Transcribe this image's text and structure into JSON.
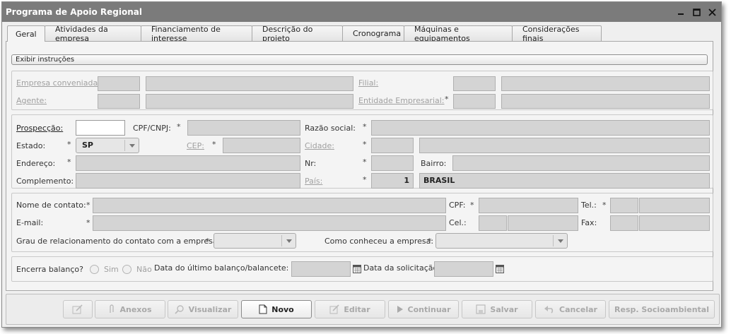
{
  "window": {
    "title": "Programa de Apoio Regional"
  },
  "tabs": [
    {
      "label": "Geral"
    },
    {
      "label": "Atividades da empresa"
    },
    {
      "label": "Financiamento de interesse"
    },
    {
      "label": "Descrição do projeto"
    },
    {
      "label": "Cronograma"
    },
    {
      "label": "Máquinas e equipamentos"
    },
    {
      "label": "Considerações finais"
    }
  ],
  "instructions_label": "Exibir instruções",
  "company": {
    "empresa_conveniada": "Empresa conveniada:",
    "filial": "Filial:",
    "agente": "Agente:",
    "entidade_empresarial": "Entidade Empresarial:"
  },
  "prospect": {
    "prospeccao": "Prospecção:",
    "cpf_cnpj": "CPF/CNPJ:",
    "razao_social": "Razão social:",
    "estado": "Estado:",
    "estado_value": "SP",
    "cep": "CEP:",
    "cidade": "Cidade:",
    "endereco": "Endereço:",
    "nr": "Nr:",
    "bairro": "Bairro:",
    "complemento": "Complemento:",
    "pais": "País:",
    "pais_code": "1",
    "pais_name": "BRASIL"
  },
  "contact": {
    "nome": "Nome de contato:",
    "cpf": "CPF:",
    "tel": "Tel.:",
    "email": "E-mail:",
    "cel": "Cel.:",
    "fax": "Fax:",
    "grau": "Grau de relacionamento do contato com a empresa:",
    "como": "Como conheceu a empresa:"
  },
  "balance": {
    "encerra": "Encerra balanço?",
    "sim": "Sim",
    "nao": "Não",
    "data_balanco": "Data do último balanço/balancete:",
    "data_solicitacao": "Data da solicitação:"
  },
  "asterisk": "*",
  "footer": {
    "anexos": "Anexos",
    "visualizar": "Visualizar",
    "novo": "Novo",
    "editar": "Editar",
    "continuar": "Continuar",
    "salvar": "Salvar",
    "cancelar": "Cancelar",
    "resp": "Resp. Socioambiental"
  }
}
